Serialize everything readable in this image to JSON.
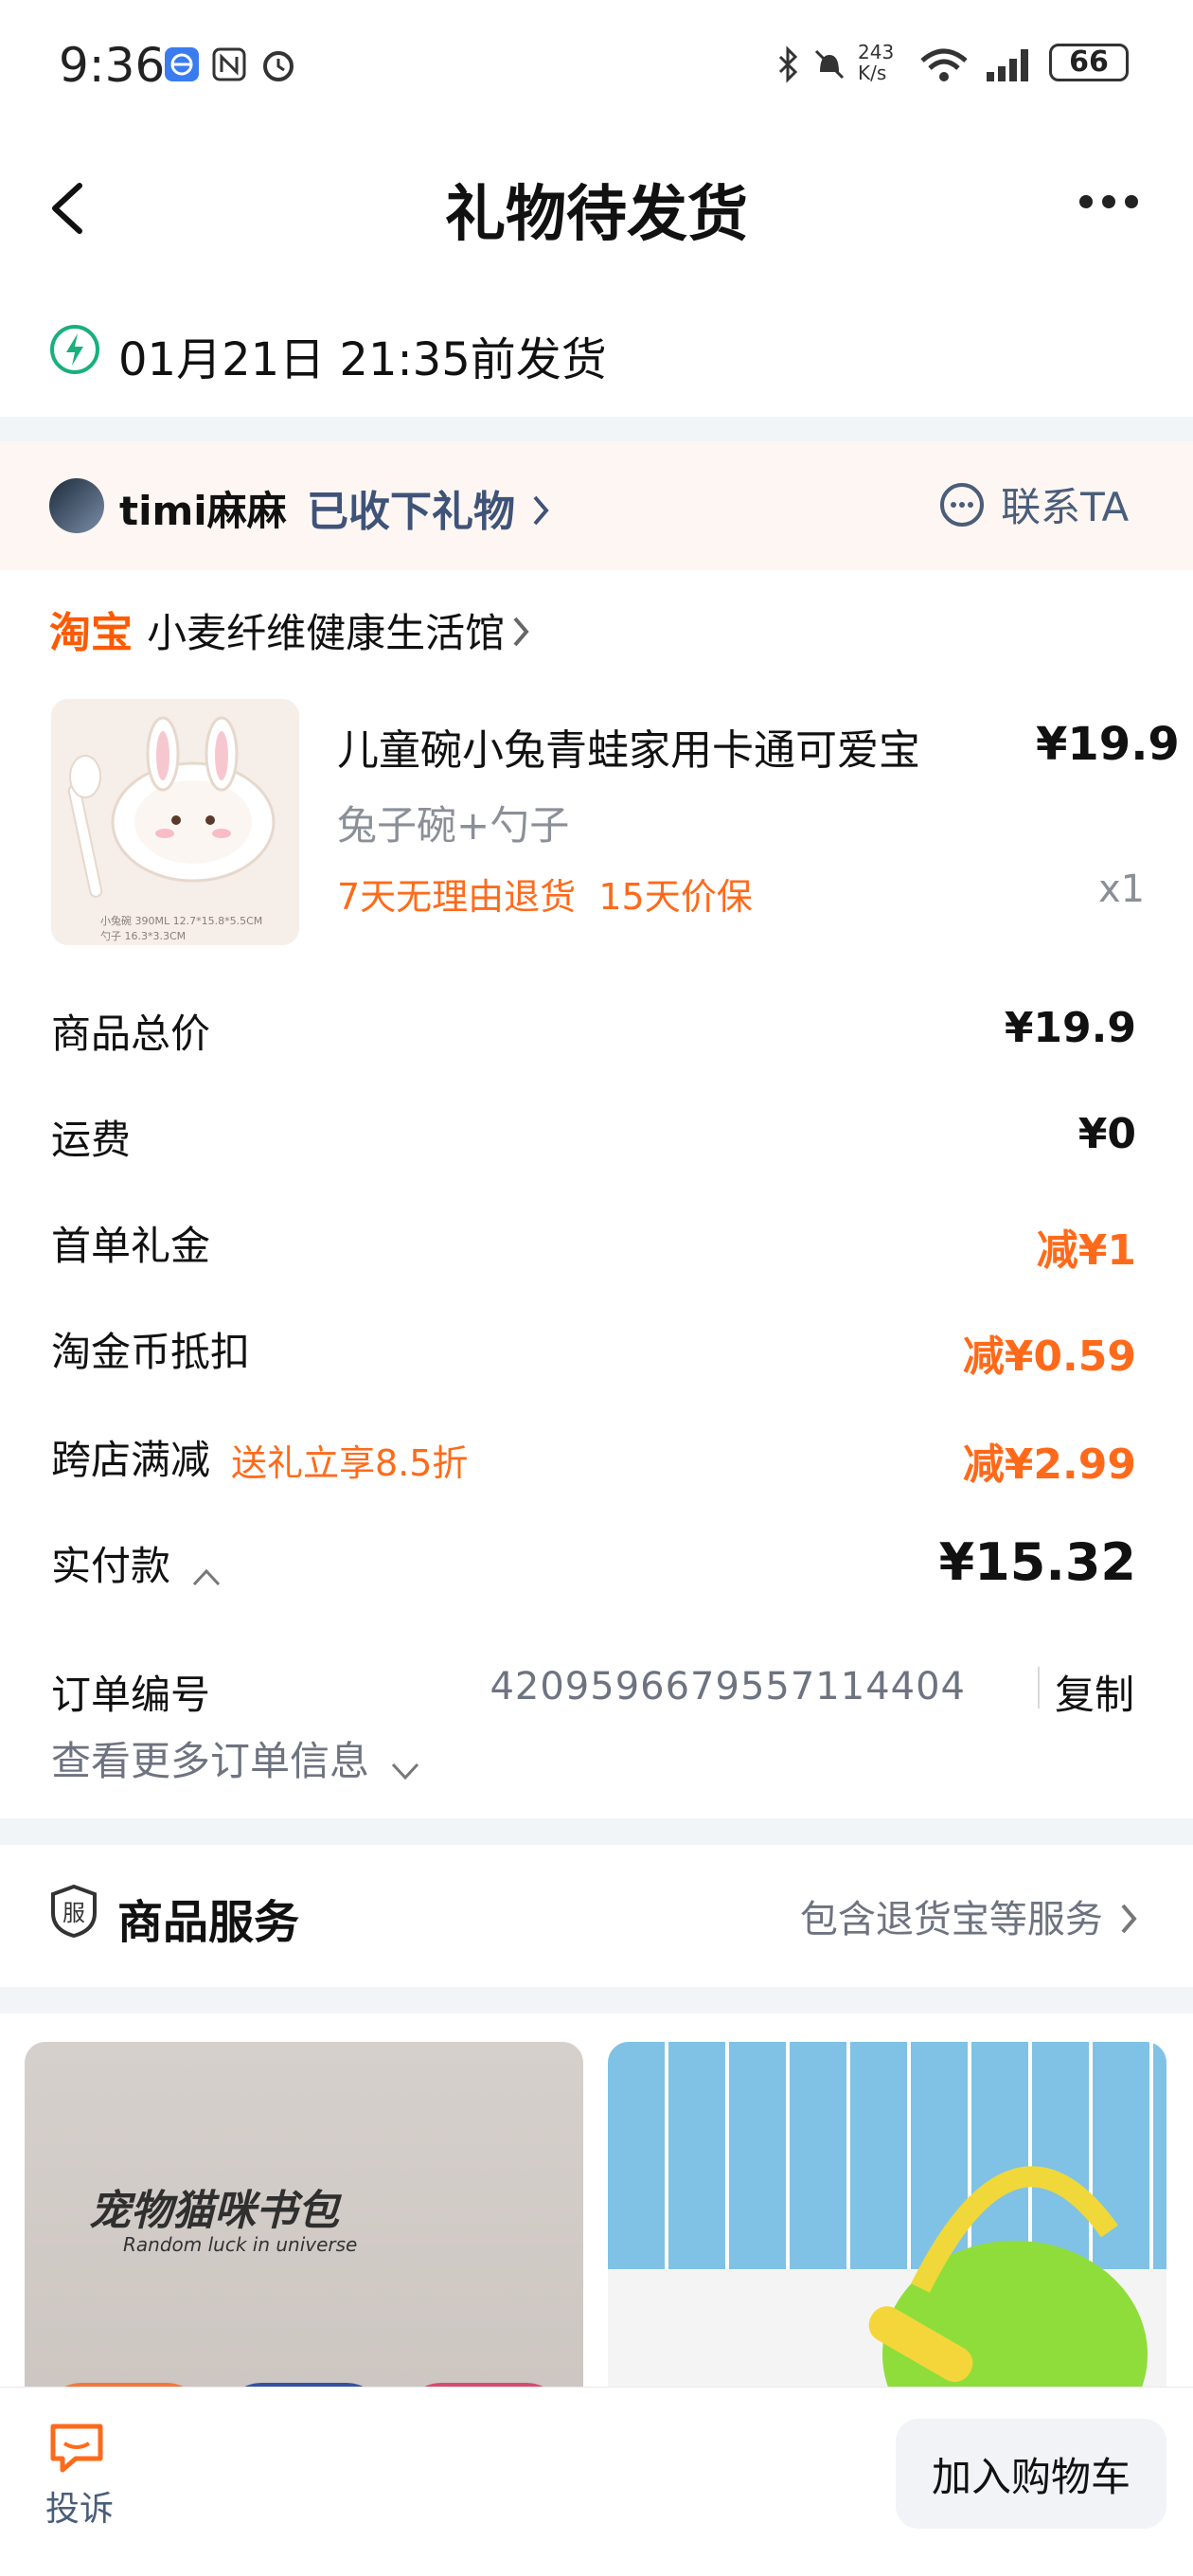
{
  "status_bar": {
    "time": "9:36",
    "net_speed": "243\nK/s",
    "battery": "66"
  },
  "header": {
    "title": "礼物待发货"
  },
  "shipping": {
    "deadline": "01月21日 21:35前发货"
  },
  "gift": {
    "recipient": "timi麻麻",
    "status": "已收下礼物",
    "contact_label": "联系TA"
  },
  "shop": {
    "platform": "淘宝",
    "name": "小麦纤维健康生活馆"
  },
  "product": {
    "title": "儿童碗小兔青蛙家用卡通可爱宝",
    "spec": "兔子碗+勺子",
    "tags": "7天无理由退货  15天价保",
    "price": "¥19.9",
    "qty": "x1",
    "thumb_caption_1": "小兔碗 390ML  12.7*15.8*5.5CM",
    "thumb_caption_2": "勺子 16.3*3.3CM"
  },
  "summary": [
    {
      "label": "商品总价",
      "value": "¥19.9",
      "orange": false
    },
    {
      "label": "运费",
      "value": "¥0",
      "orange": false
    },
    {
      "label": "首单礼金",
      "value": "减¥1",
      "orange": true
    },
    {
      "label": "淘金币抵扣",
      "value": "减¥0.59",
      "orange": true
    },
    {
      "label": "跨店满减",
      "value": "减¥2.99",
      "orange": true,
      "subtag": "送礼立享8.5折"
    }
  ],
  "paid": {
    "label": "实付款",
    "value": "¥15.32"
  },
  "order": {
    "label": "订单编号",
    "number": "4209596679557114404",
    "copy_label": "复制",
    "more_label": "查看更多订单信息"
  },
  "service": {
    "label": "商品服务",
    "detail": "包含退货宝等服务"
  },
  "recommend": [
    {
      "title": "宠物猫咪书包",
      "subtitle": "Random luck in universe"
    },
    {
      "title": ""
    }
  ],
  "bottom_bar": {
    "complain_label": "投诉",
    "cart_label": "加入购物车"
  },
  "colors": {
    "accent": "#ff6a1a",
    "platform": "#ff5a00",
    "link": "#3f5378"
  }
}
